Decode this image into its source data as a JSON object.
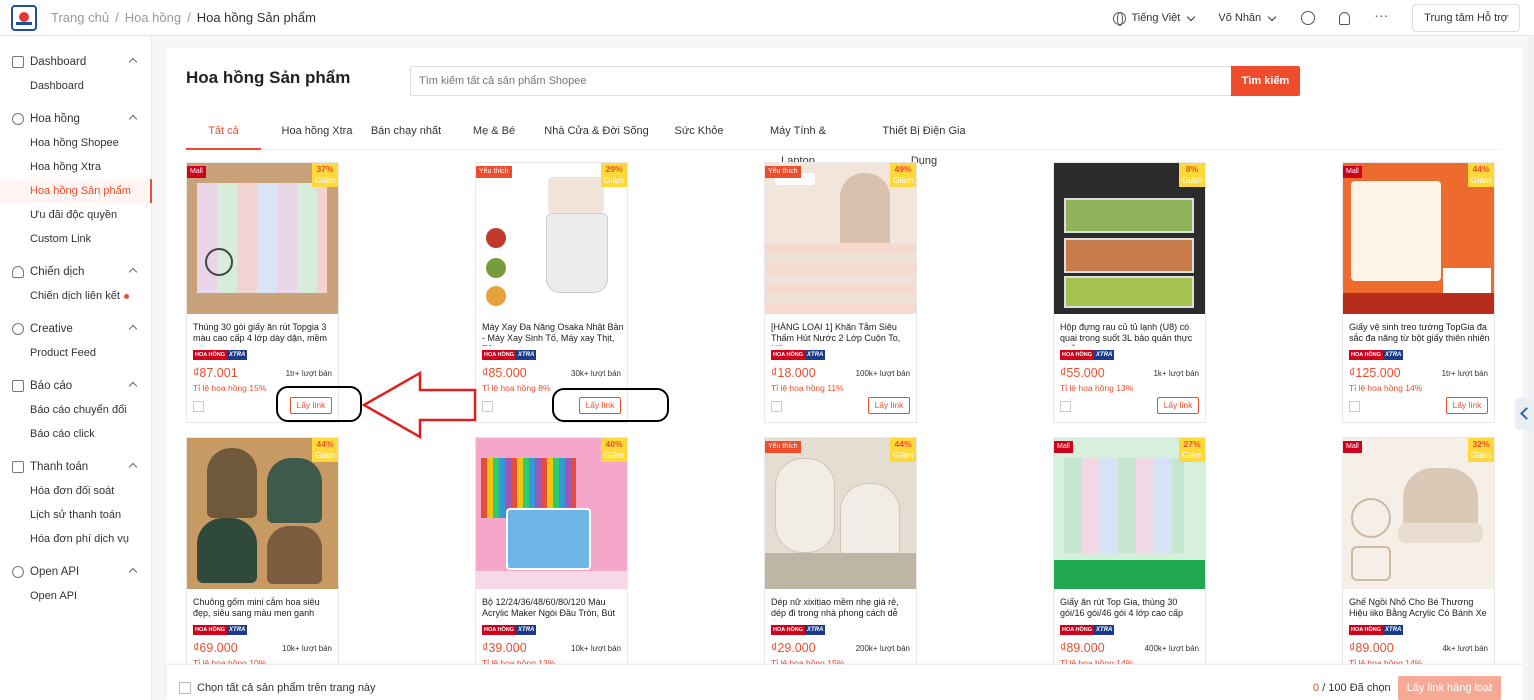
{
  "breadcrumb": [
    "Trang chủ",
    "/",
    "Hoa hồng",
    "/",
    "Hoa hồng Sản phẩm"
  ],
  "topbar": {
    "language": "Tiếng Việt",
    "user": "Võ Nhân",
    "help": "Trung tâm Hỗ trợ"
  },
  "sidebar": {
    "dashboard": {
      "title": "Dashboard",
      "items": [
        "Dashboard"
      ]
    },
    "hoahong": {
      "title": "Hoa hồng",
      "items": [
        "Hoa hồng Shopee",
        "Hoa hồng Xtra",
        "Hoa hồng Sản phẩm",
        "Ưu đãi độc quyền",
        "Custom Link"
      ]
    },
    "chiendich": {
      "title": "Chiến dịch",
      "items": [
        "Chiến dịch liên kết"
      ]
    },
    "creative": {
      "title": "Creative",
      "items": [
        "Product Feed"
      ]
    },
    "baocao": {
      "title": "Báo cáo",
      "items": [
        "Báo cáo chuyển đổi",
        "Báo cáo click"
      ]
    },
    "thanhtoan": {
      "title": "Thanh toán",
      "items": [
        "Hóa đơn đối soát",
        "Lịch sử thanh toán",
        "Hóa đơn phí dịch vụ"
      ]
    },
    "openapi": {
      "title": "Open API",
      "items": [
        "Open API"
      ]
    }
  },
  "main": {
    "title": "Hoa hồng Sản phẩm",
    "search_placeholder": "Tìm kiếm tất cả sản phẩm Shopee",
    "search_button": "Tìm kiếm",
    "tabs": [
      "Tất cả",
      "Hoa hồng Xtra",
      "Bán chạy nhất",
      "Mẹ & Bé",
      "Nhà Cửa & Đời Sống",
      "Sức Khỏe",
      "Máy Tính & Laptop",
      "Thiết Bị Điện Gia Dụng"
    ]
  },
  "labels": {
    "get_link": "Lấy link",
    "badge_hh": "HOA HỒNG",
    "badge_xtra": "XTRA",
    "discount_word": "Giảm"
  },
  "products": [
    {
      "name": "Thùng 30 gói giấy ăn rút Topgia 3 màu cao cấp 4 lớp dày dặn, mềm mịn",
      "price": "₫87.001",
      "sold": "1tr+ lượt bán",
      "rate": "Tỉ lệ hoa hồng 15%",
      "discount": "37%",
      "tag": "Mall"
    },
    {
      "name": "Máy Xay Đa Năng Osaka Nhật Bản - Máy Xay Sinh Tố, Máy xay Thịt, Tỏi",
      "price": "₫85.000",
      "sold": "30k+ lượt bán",
      "rate": "Tỉ lệ hoa hồng 8%",
      "discount": "29%",
      "tag": "Yêu thích"
    },
    {
      "name": "[HÀNG LOẠI 1] Khăn Tắm Siêu Thấm Hút Nước 2 Lớp Cuộn To, Mềm",
      "price": "₫18.000",
      "sold": "100k+ lượt bán",
      "rate": "Tỉ lệ hoa hồng 11%",
      "discount": "49%",
      "tag": "Yêu thích"
    },
    {
      "name": "Hộp đựng rau củ tủ lạnh (U8) có quai trong suốt 3L bảo quản thực phẩm",
      "price": "₫55.000",
      "sold": "1k+ lượt bán",
      "rate": "Tỉ lệ hoa hồng 13%",
      "discount": "8%",
      "tag": ""
    },
    {
      "name": "Giấy vệ sinh treo tường TopGia đa sắc đa năng từ bột giấy thiên nhiên",
      "price": "₫125.000",
      "sold": "1tr+ lượt bán",
      "rate": "Tỉ lệ hoa hồng 14%",
      "discount": "44%",
      "tag": "Mall"
    },
    {
      "name": "Chuông gốm mini cắm hoa siêu đẹp, siêu sang màu men ganh",
      "price": "₫69.000",
      "sold": "10k+ lượt bán",
      "rate": "Tỉ lệ hoa hồng 10%",
      "discount": "44%",
      "tag": ""
    },
    {
      "name": "Bộ 12/24/36/48/60/80/120 Màu Acrylic Maker Ngòi Đầu Tròn, Bút",
      "price": "₫39.000",
      "sold": "10k+ lượt bán",
      "rate": "Tỉ lệ hoa hồng 13%",
      "discount": "40%",
      "tag": ""
    },
    {
      "name": "Dép nữ xixitiao mềm nhẹ giá rẻ, dép đi trong nhà phong cách dễ thương",
      "price": "₫29.000",
      "sold": "200k+ lượt bán",
      "rate": "Tỉ lệ hoa hồng 15%",
      "discount": "44%",
      "tag": "Yêu thích"
    },
    {
      "name": "Giấy ăn rút Top Gia, thùng 30 gói/16 gói/46 gói 4 lớp cao cấp",
      "price": "₫89.000",
      "sold": "400k+ lượt bán",
      "rate": "Tỉ lệ hoa hồng 14%",
      "discount": "27%",
      "tag": "Mall"
    },
    {
      "name": "Ghế Ngồi Nhỏ Cho Bé Thương Hiệu iiko Bằng Acrylic Có Bánh Xe",
      "price": "₫89.000",
      "sold": "4k+ lượt bán",
      "rate": "Tỉ lệ hoa hồng 14%",
      "discount": "32%",
      "tag": "Mall"
    }
  ],
  "bottom": {
    "select_all": "Chọn tất cả sản phẩm trên trang này",
    "count": "0",
    "count_total": "/ 100 Đã chọn",
    "bulk_button": "Lấy link hàng loạt"
  },
  "colors": {
    "accent": "#ee4d2d",
    "annotation_arrow": "#e02020"
  }
}
